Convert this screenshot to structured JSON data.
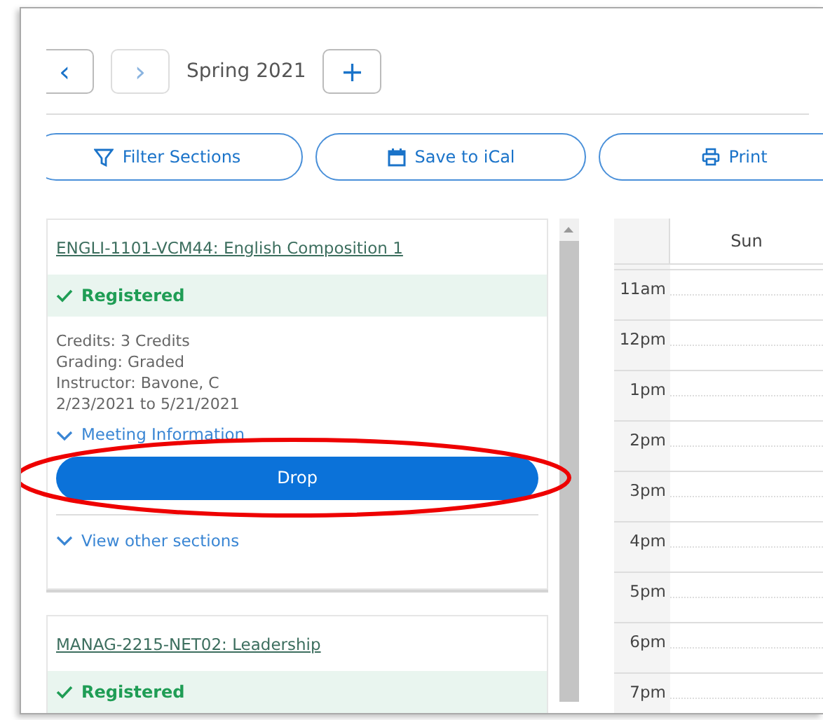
{
  "term_nav": {
    "previous": "‹",
    "next": "›",
    "term": "Spring 2021",
    "add": "+"
  },
  "actions": [
    {
      "kind": "filter",
      "label": "Filter Sections"
    },
    {
      "kind": "calendar",
      "label": "Save to iCal"
    },
    {
      "kind": "print",
      "label": "Print"
    }
  ],
  "courses": [
    {
      "title": "ENGLI-1101-VCM44: English Composition 1",
      "status": {
        "kind": "registered",
        "label": "Registered"
      },
      "details": [
        "Credits: 3 Credits",
        "Grading: Graded",
        "Instructor: Bavone, C",
        "2/23/2021 to 5/21/2021"
      ],
      "meeting_toggle": {
        "label": "Meeting Information",
        "expanded": false
      },
      "drop_button": "Drop",
      "other_sections": {
        "label": "View other sections",
        "expanded": false
      },
      "highlighted": true
    },
    {
      "title": "MANAG-2215-NET02: Leadership",
      "status": {
        "kind": "registered",
        "label": "Registered"
      }
    }
  ],
  "calendar": {
    "columns": [
      "Sun"
    ],
    "hours": [
      "11am",
      "12pm",
      "1pm",
      "2pm",
      "3pm",
      "4pm",
      "5pm",
      "6pm",
      "7pm"
    ]
  }
}
